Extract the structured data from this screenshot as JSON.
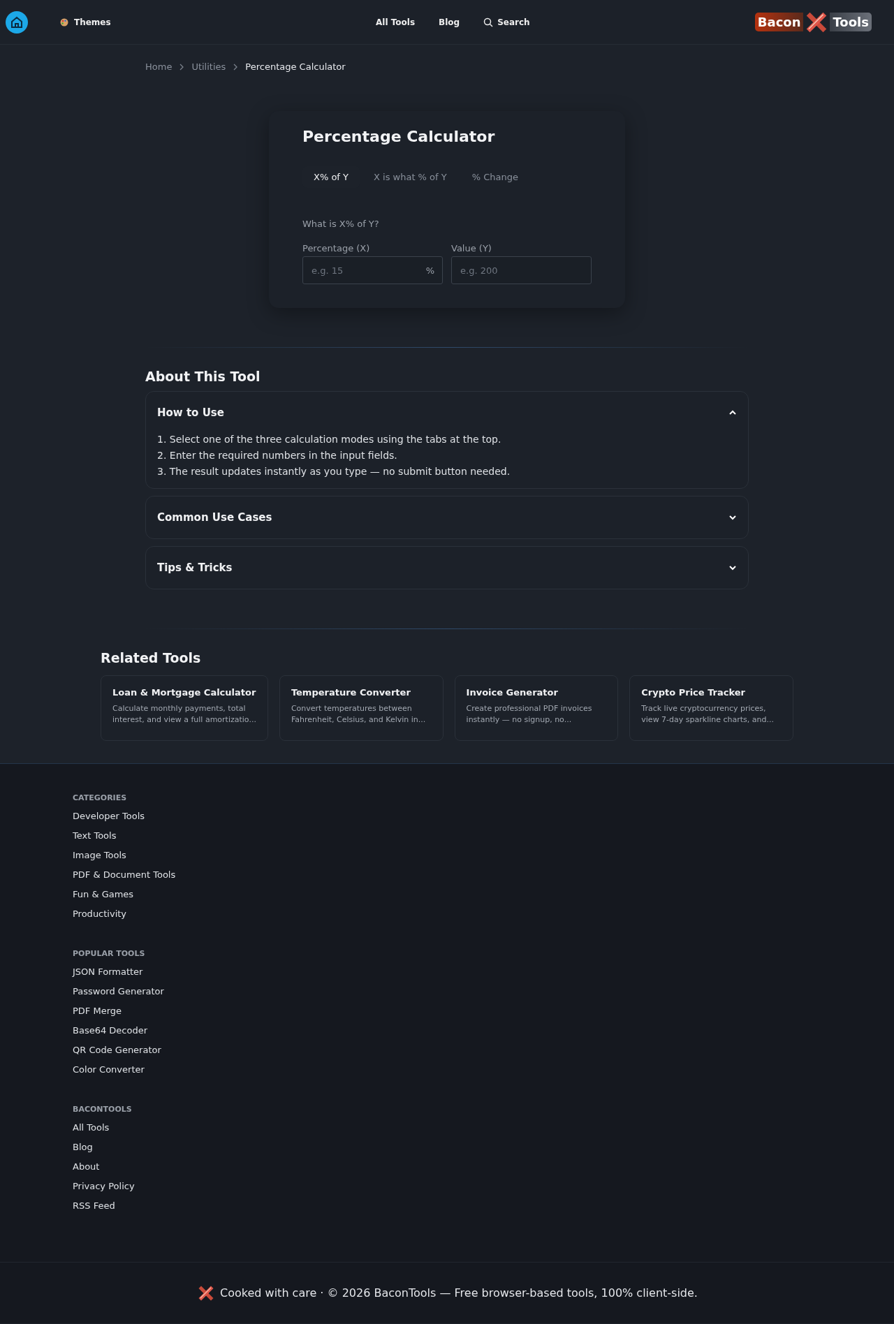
{
  "header": {
    "themes_label": "Themes",
    "nav": [
      "All Tools",
      "Blog"
    ],
    "search_label": "Search",
    "logo": {
      "left": "Bacon",
      "right": "Tools"
    }
  },
  "breadcrumb": [
    "Home",
    "Utilities",
    "Percentage Calculator"
  ],
  "calculator": {
    "title": "Percentage Calculator",
    "tabs": [
      {
        "label": "X% of Y",
        "selected": true
      },
      {
        "label": "X is what % of Y",
        "selected": false
      },
      {
        "label": "% Change",
        "selected": false
      }
    ],
    "question": "What is X% of Y?",
    "fields": [
      {
        "label": "Percentage (X)",
        "placeholder": "e.g. 15",
        "suffix": "%"
      },
      {
        "label": "Value (Y)",
        "placeholder": "e.g. 200"
      }
    ]
  },
  "about": {
    "title": "About This Tool",
    "sections": [
      {
        "title": "How to Use",
        "expanded": true,
        "lines": [
          "1. Select one of the three calculation modes using the tabs at the top.",
          "2. Enter the required numbers in the input fields.",
          "3. The result updates instantly as you type — no submit button needed."
        ]
      },
      {
        "title": "Common Use Cases",
        "expanded": false
      },
      {
        "title": "Tips & Tricks",
        "expanded": false
      }
    ]
  },
  "related": {
    "title": "Related Tools",
    "cards": [
      {
        "title": "Loan & Mortgage Calculator",
        "lines": [
          "Calculate monthly payments, total",
          "interest, and view a full amortizatio..."
        ]
      },
      {
        "title": "Temperature Converter",
        "lines": [
          "Convert temperatures between",
          "Fahrenheit, Celsius, and Kelvin in..."
        ]
      },
      {
        "title": "Invoice Generator",
        "lines": [
          "Create professional PDF invoices",
          "instantly — no signup, no..."
        ]
      },
      {
        "title": "Crypto Price Tracker",
        "lines": [
          "Track live cryptocurrency prices,",
          "view 7-day sparkline charts, and..."
        ]
      }
    ]
  },
  "footer": {
    "groups": [
      {
        "heading": "CATEGORIES",
        "links": [
          "Developer Tools",
          "Text Tools",
          "Image Tools",
          "PDF & Document Tools",
          "Fun & Games",
          "Productivity"
        ]
      },
      {
        "heading": "POPULAR TOOLS",
        "links": [
          "JSON Formatter",
          "Password Generator",
          "PDF Merge",
          "Base64 Decoder",
          "QR Code Generator",
          "Color Converter"
        ]
      },
      {
        "heading": "BACONTOOLS",
        "links": [
          "All Tools",
          "Blog",
          "About",
          "Privacy Policy",
          "RSS Feed"
        ]
      }
    ],
    "copyright": "Cooked with care · © 2026 BaconTools — Free browser-based tools, 100% client-side."
  }
}
